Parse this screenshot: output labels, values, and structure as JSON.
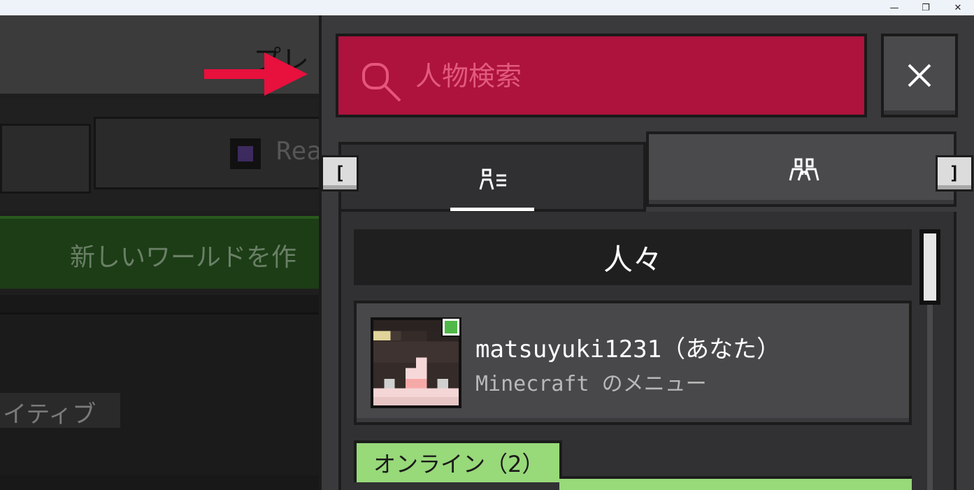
{
  "window": {
    "minimize_glyph": "—",
    "maximize_glyph": "❐",
    "close_glyph": "✕"
  },
  "background": {
    "header_title": "プレ",
    "realms_button_label": "Rea",
    "create_world_label": "新しいワールドを作",
    "game_mode_label": "イティブ"
  },
  "search": {
    "placeholder": "人物検索",
    "value": ""
  },
  "tabs": [
    {
      "id": "friends",
      "icon": "friends-list-icon",
      "selected": true
    },
    {
      "id": "social",
      "icon": "social-group-icon",
      "selected": false
    }
  ],
  "brackets": {
    "left": "[",
    "right": "]"
  },
  "people": {
    "header": "人々",
    "current_user": {
      "name": "matsuyuki1231",
      "suffix": "（あなた）",
      "status": "Minecraft のメニュー",
      "online": true
    },
    "online_section_label": "オンライン（2）"
  },
  "colors": {
    "search_bg": "#ad133d",
    "online_green": "#98d97a",
    "status_green": "#4fb848",
    "arrow_red": "#e8103c"
  }
}
